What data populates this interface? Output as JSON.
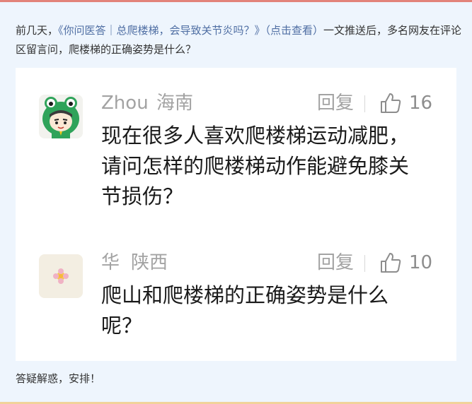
{
  "intro": {
    "prefix": "前几天，",
    "link": "《你问医答｜总爬楼梯，会导致关节炎吗？》（点击查看）",
    "suffix": "一文推送后，多名网友在评论区留言问，爬楼梯的正确姿势是什么？"
  },
  "comments": [
    {
      "user": "Zhou",
      "location": "海南",
      "reply_label": "回复",
      "likes": "16",
      "text": "现在很多人喜欢爬楼梯运动减肥，请问怎样的爬楼梯动作能避免膝关节损伤？",
      "avatar_icon": "frog-hat-cartoon-avatar-icon"
    },
    {
      "user": "华",
      "location": "陕西",
      "reply_label": "回复",
      "likes": "10",
      "text": "爬山和爬楼梯的正确姿势是什么呢？",
      "avatar_icon": "flower-avatar-icon"
    }
  ],
  "footer": {
    "text": "答疑解惑，安排！"
  },
  "colors": {
    "page_bg": "#eef5fd",
    "top_border": "#e2837a",
    "bottom_border": "#f1d29a",
    "link": "#4f6ea3",
    "meta_gray": "#a3a3a3"
  }
}
